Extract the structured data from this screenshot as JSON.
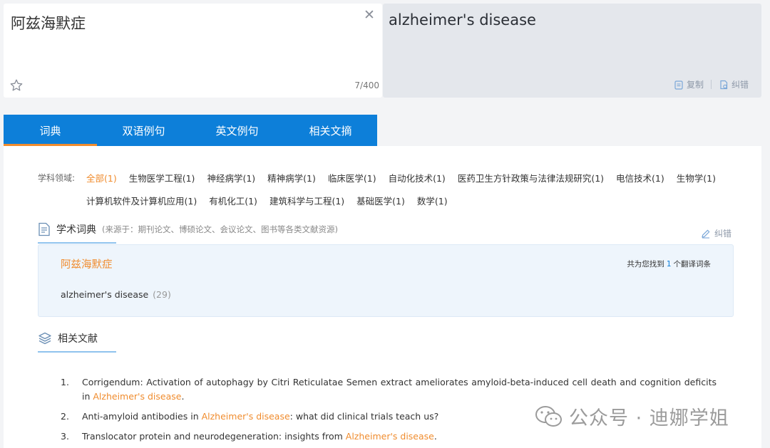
{
  "translator": {
    "source_text": "阿兹海默症",
    "char_count": "7/400",
    "target_text": "alzheimer's disease",
    "copy_label": "复制",
    "correct_label": "纠错"
  },
  "tabs": [
    {
      "label": "词典"
    },
    {
      "label": "双语例句"
    },
    {
      "label": "英文例句"
    },
    {
      "label": "相关文摘"
    }
  ],
  "filter": {
    "label": "学科领域:",
    "row1": [
      "全部(1)",
      "生物医学工程(1)",
      "神经病学(1)",
      "精神病学(1)",
      "临床医学(1)",
      "自动化技术(1)",
      "医药卫生方针政策与法律法规研究(1)",
      "电信技术(1)",
      "生物学(1)"
    ],
    "row2": [
      "计算机软件及计算机应用(1)",
      "有机化工(1)",
      "建筑科学与工程(1)",
      "基础医学(1)",
      "数学(1)"
    ]
  },
  "dict_section": {
    "title": "学术词典",
    "source_note": "(来源于：期刊论文、博硕论文、会议论文、图书等各类文献资源)",
    "correct_label": "纠错",
    "term": "阿兹海默症",
    "count_prefix": "共为您找到",
    "count_num": "1",
    "count_suffix": "个翻译词条",
    "translation": "alzheimer's disease",
    "translation_count": "(29)"
  },
  "refs_section": {
    "title": "相关文献",
    "items": [
      {
        "idx": "1.",
        "pre": "Corrigendum: Activation of autophagy by Citri Reticulatae Semen extract ameliorates amyloid-beta-induced cell death and cognition deficits in ",
        "hl": "Alzheimer's disease",
        "post": "."
      },
      {
        "idx": "2.",
        "pre": "Anti-amyloid antibodies in ",
        "hl": "Alzheimer's disease",
        "post": ": what did clinical trials teach us?"
      },
      {
        "idx": "3.",
        "pre": "Translocator protein and neurodegeneration: insights from ",
        "hl": "Alzheimer's disease",
        "post": "."
      }
    ]
  },
  "watermark": {
    "text": "公众号 · 迪娜学姐"
  }
}
